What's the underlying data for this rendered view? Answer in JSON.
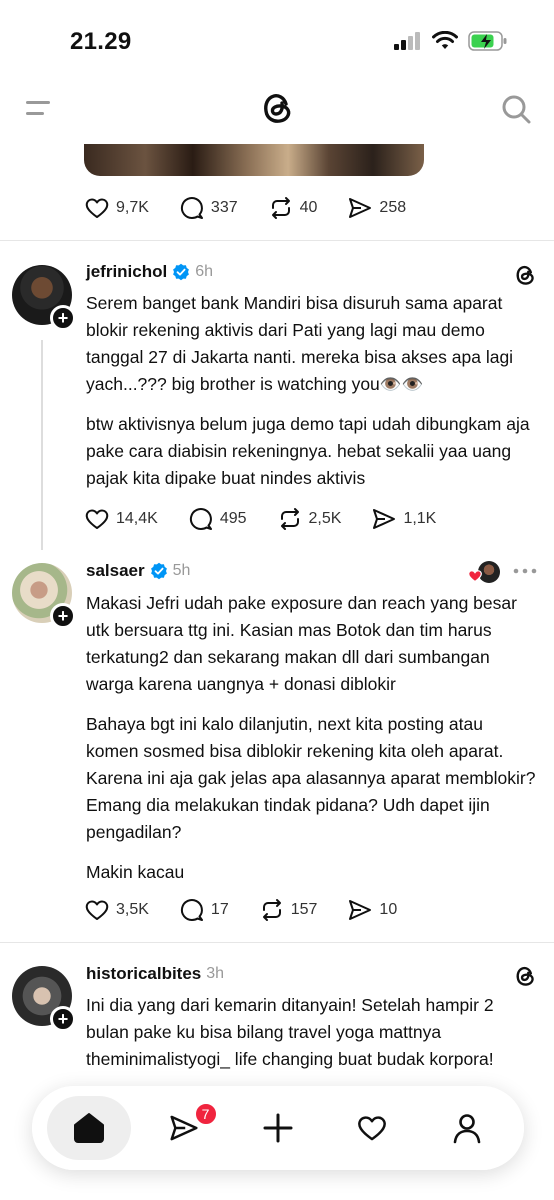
{
  "status": {
    "time": "21.29"
  },
  "prev_post": {
    "likes": "9,7K",
    "replies": "337",
    "reposts": "40",
    "shares": "258"
  },
  "posts": [
    {
      "username": "jefrinichol",
      "time": "6h",
      "paragraphs": [
        "Serem banget bank Mandiri bisa disuruh sama aparat blokir rekening aktivis dari Pati yang lagi mau demo tanggal 27 di Jakarta nanti. mereka bisa akses apa lagi yach...??? big brother is watching you👁️👁️",
        "btw aktivisnya belum juga demo tapi udah dibungkam aja pake cara diabisin rekeningnya. hebat sekalii yaa uang pajak kita dipake buat nindes aktivis"
      ],
      "likes": "14,4K",
      "replies": "495",
      "reposts": "2,5K",
      "shares": "1,1K"
    },
    {
      "username": "salsaer",
      "time": "5h",
      "paragraphs": [
        "Makasi Jefri udah pake exposure dan reach yang besar utk bersuara ttg ini. Kasian mas Botok dan tim harus terkatung2 dan sekarang makan dll dari sumbangan warga karena uangnya + donasi diblokir",
        "Bahaya bgt ini kalo dilanjutin, next kita posting atau komen sosmed bisa diblokir rekening kita oleh aparat. Karena ini aja gak jelas apa alasannya aparat memblokir? Emang dia melakukan tindak pidana? Udh dapet ijin pengadilan?",
        "Makin kacau"
      ],
      "likes": "3,5K",
      "replies": "17",
      "reposts": "157",
      "shares": "10"
    },
    {
      "username": "historicalbites",
      "time": "3h",
      "paragraphs": [
        "Ini dia yang dari kemarin ditanyain! Setelah hampir 2 bulan pake ku bisa bilang travel yoga mattnya theminimalistyogi_ life changing buat budak korpora!"
      ]
    }
  ],
  "nav": {
    "messages_badge": "7"
  },
  "icons": [
    "menu-icon",
    "threads-logo-icon",
    "search-icon",
    "heart-icon",
    "reply-icon",
    "repost-icon",
    "share-icon",
    "verified-icon",
    "plus-icon",
    "more-icon",
    "home-icon",
    "send-icon",
    "create-icon",
    "activity-icon",
    "profile-icon"
  ]
}
